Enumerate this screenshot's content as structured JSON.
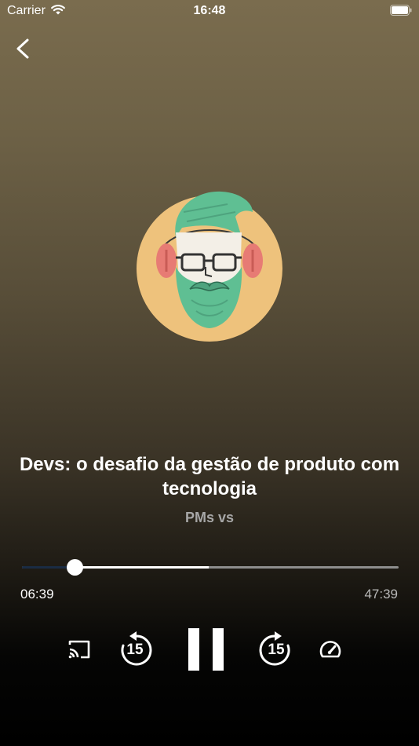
{
  "status_bar": {
    "carrier": "Carrier",
    "time": "16:48"
  },
  "episode": {
    "title": "Devs: o desafio da gestão de produto com tecnologia",
    "podcast": "PMs vs"
  },
  "player": {
    "elapsed": "06:39",
    "total": "47:39",
    "progress_fraction": 0.14,
    "buffered_fraction": 0.495,
    "rewind_seconds": "15",
    "forward_seconds": "15"
  },
  "colors": {
    "accent_played": "#1a2c44",
    "secondary_text": "#a7a7a7",
    "art_background": "#eec27c",
    "art_beard": "#5fbf93",
    "art_headphones": "#e77b74"
  },
  "icons": [
    "back-chevron-icon",
    "wifi-icon",
    "battery-icon",
    "cast-icon",
    "rewind-15-icon",
    "pause-icon",
    "forward-15-icon",
    "speedometer-icon"
  ]
}
